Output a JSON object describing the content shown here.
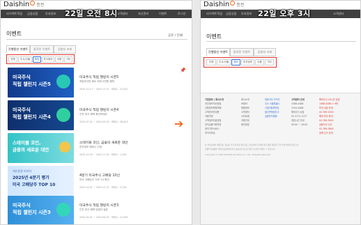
{
  "brand": {
    "name": "Daishin",
    "sub": "증권"
  },
  "left": {
    "overlay": "22일 오전 8시",
    "nav": [
      "다이렉트적립",
      "금융상품",
      "투자정보",
      "고객센터",
      "자산관리",
      "이벤트",
      "로그인"
    ],
    "page_title": "이벤트",
    "tools": "공유 / 인쇄",
    "tabs": [
      "진행중인 이벤트",
      "종료된 이벤트",
      "당첨자 조회"
    ],
    "chips": [
      "전체",
      "주식/선물",
      "해외",
      "투자정보",
      "이용",
      "기타"
    ],
    "events": [
      {
        "thumb_lines": [
          "미국주식",
          "적립 챌린지 시즌5"
        ],
        "title": "미국주식 적립 챌린지 시즌5",
        "desc": "적립하기만 해도 최대 5만원 혜택",
        "date": "2025.10.13 ~ 2025.12.31 · 조회수 : 24,447"
      },
      {
        "thumb_lines": [
          "미국주식",
          "적립 챌린지 시즌4"
        ],
        "title": "미국주식 적립 챌린지 시즌4",
        "desc": "인천 최고 혜택 확인하세요",
        "date": "2025.07.01 ~ 2025.09.30 · 조회수 : 38,622"
      },
      {
        "thumb_lines": [
          "스테이블 코인,",
          "금융의 새로운 대안"
        ],
        "title": "스테이블 코인, 금융의 새로운 대안",
        "desc": "투자정보 웨비나 신청",
        "date": "2025.10.20 ~ 2025.11.30 · 조회수 : 1,204"
      },
      {
        "thumb_small": "대신증권 리서치",
        "thumb_lines": [
          "2025년 4분기 평가",
          "미국 고배당주 TOP 10"
        ],
        "title": "4분기 미국주식 고배당 10선",
        "desc": "미국 고배당주 TOP 10 확인",
        "date": "2025.10.01 ~ 2025.12.31 · 조회수 : 5,318"
      },
      {
        "thumb_lines": [
          "미국주식",
          "적립 챌린지 시즌3"
        ],
        "title": "미국주식 적립 챌린지 시즌3",
        "desc": "인천 최고 혜택 당첨자 발표",
        "date": "2025.04.01 ~ 2025.06.30 · 조회수 : 41,905"
      }
    ]
  },
  "right": {
    "overlay": "22일 오후 3시",
    "nav": [
      "다이렉트적립",
      "금융상품",
      "투자정보",
      "고객센터"
    ],
    "page_title": "이벤트",
    "tabs": [
      "진행중인 이벤트",
      "종료된 이벤트",
      "당첨자 조회"
    ],
    "chips": [
      "전체",
      "주식/선물",
      "해외",
      "투자정보",
      "이용",
      "기타"
    ],
    "footer_cols": [
      {
        "lines": [
          "기업정보 | 회사소개",
          "개인정보처리방침",
          "신용정보활용체제",
          "고객권리안내문",
          "이용약관",
          "고객정보취급방침",
          "전자금융거래약관",
          "위치기반서비스",
          "투자자보호"
        ]
      },
      {
        "lines": [
          "회사소개",
          "IR정보",
          "채용정보",
          "고객센터",
          "사이트맵",
          "이용안내",
          "윤리경영",
          "",
          "",
          ""
        ]
      },
      {
        "lines": [
          "대표이사 오익근",
          "주소 서울특별시",
          "사업자등록번호",
          "통신판매업신고",
          "금융투자협회",
          "",
          "",
          "",
          ""
        ]
      },
      {
        "lines": [
          "고객센터 안내",
          "1588-4488",
          "1544-4488",
          "해외주식 상담",
          "02-3772-1077",
          "영업시간 안내",
          "09:00 ~ 18:00",
          "",
          "",
          ""
        ]
      },
      {
        "lines": [
          "해외주식 24시간 상담",
          "1588-4488 > 9번",
          "투자 상담 안내",
          "02-769-2000",
          "해외 투자 문의",
          "02-769-3000",
          "금융사고 신고",
          "02-769-3800",
          "",
          "장애 신고 안내"
        ]
      }
    ],
    "notes": [
      "본 사이트에서 제공되는 정보는 투자 판단을 위한 참고 자료이며 투자에 대한 최종 결정은 투자자 본인에게 있습니다.",
      "금융투자상품은 예금자보호법에 따라 보호되지 않으며 원금 손실이 발생할 수 있습니다.",
      "Copyright (c) 2025 DAISHIN Securities Co., Ltd. All Rights Reserved."
    ]
  },
  "colors": {
    "accent": "#f26a22",
    "brand_blue": "#2f6fd3",
    "highlight_red": "#e4332a"
  }
}
